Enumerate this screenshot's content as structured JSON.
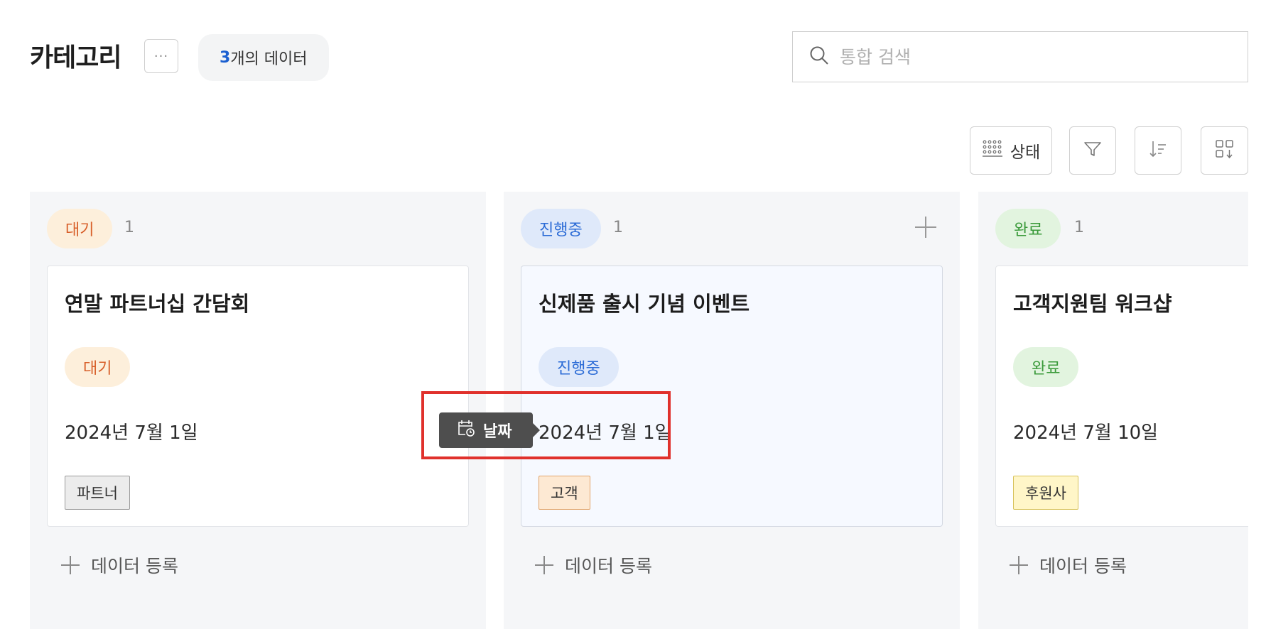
{
  "header": {
    "title": "카테고리",
    "more_label": "···",
    "count_number": "3",
    "count_suffix": "개의 데이터"
  },
  "search": {
    "placeholder": "통합 검색",
    "value": ""
  },
  "toolbar": {
    "status_label": "상태",
    "filter_icon": "filter-icon",
    "sort_icon": "sort-icon",
    "view_icon": "view-layout-icon"
  },
  "columns": [
    {
      "status": "대기",
      "count": "1",
      "card": {
        "title": "연말 파트너십 간담회",
        "status": "대기",
        "date": "2024년 7월 1일",
        "tag": "파트너"
      },
      "add_label": "데이터 등록"
    },
    {
      "status": "진행중",
      "count": "1",
      "card": {
        "title": "신제품 출시 기념 이벤트",
        "status": "진행중",
        "date": "2024년 7월 1일",
        "tag": "고객"
      },
      "add_label": "데이터 등록"
    },
    {
      "status": "완료",
      "count": "1",
      "card": {
        "title": "고객지원팀 워크샵",
        "status": "완료",
        "date": "2024년 7월 10일",
        "tag": "후원사"
      },
      "add_label": "데이터 등록"
    }
  ],
  "tooltip": {
    "label": "날짜",
    "icon": "calendar-clock-icon"
  },
  "colors": {
    "wait_text": "#d8602b",
    "wait_bg": "#fdefdb",
    "progress_text": "#2b6bd6",
    "progress_bg": "#dfe9fa",
    "done_text": "#3a9a3a",
    "done_bg": "#e2f4df",
    "highlight": "#e0312c",
    "accent": "#1a5fd0"
  }
}
